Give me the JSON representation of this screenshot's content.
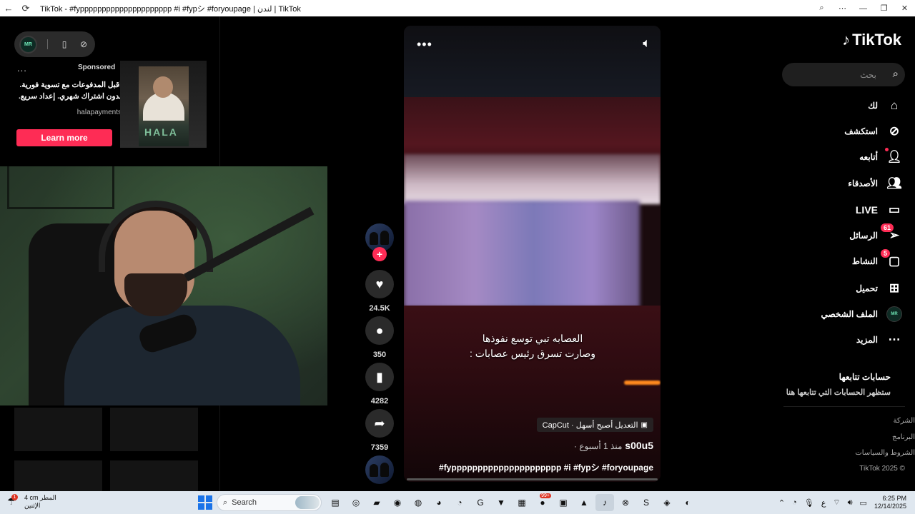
{
  "window": {
    "title": "TikTok - #fyppppppppppppppppppppp #i #fypシ #foryoupage | لندن | TikTok",
    "controls": [
      "zoom-icon",
      "more-icon",
      "minimize-icon",
      "maximize-icon",
      "close-icon"
    ]
  },
  "left": {
    "ad": {
      "more": "...",
      "sponsored_label": "Sponsored",
      "text": "اقبل المدفوعات مع تسوية فورية. بدون اشتراك شهري. إعداد سريع.",
      "brand": "halapayments",
      "cta": "Learn more",
      "thumb_logo": "HALA"
    }
  },
  "video": {
    "more": "•••",
    "caption_line1": "العصابه تبي توسع نفوذها",
    "caption_line2": "وصارت تسرق رئيس عصابات :",
    "capcut_label": "CapCut · التعديل أصبح أسهل",
    "author": "s00u5",
    "posted_ago": "· منذ 1 أسبوع",
    "hashtags": "#fyppppppppppppppppppppp #i #fypシ #foryoupage"
  },
  "actions": {
    "likes": "24.5K",
    "comments": "350",
    "saves": "4282",
    "shares": "7359"
  },
  "sidebar": {
    "brand": "TikTok",
    "search_placeholder": "بحث",
    "items": [
      {
        "label": "لك",
        "icon": "home-icon"
      },
      {
        "label": "استكشف",
        "icon": "compass-icon"
      },
      {
        "label": "أتابعه",
        "icon": "following-icon"
      },
      {
        "label": "الأصدقاء",
        "icon": "friends-icon"
      },
      {
        "label": "LIVE",
        "icon": "live-icon"
      },
      {
        "label": "الرسائل",
        "icon": "messages-icon",
        "badge": "61"
      },
      {
        "label": "النشاط",
        "icon": "activity-icon",
        "badge": "5"
      },
      {
        "label": "تحميل",
        "icon": "upload-icon"
      },
      {
        "label": "الملف الشخصي",
        "icon": "profile-icon"
      },
      {
        "label": "المزيد",
        "icon": "more-icon"
      }
    ],
    "following_heading": "حسابات تتابعها",
    "following_sub": "ستظهر الحسابات التي تتابعها هنا",
    "footer": [
      "الشركة",
      "البرنامج",
      "الشروط والسياسات",
      "© 2025 TikTok"
    ]
  },
  "taskbar": {
    "weather_line1": "4 cm المطر",
    "weather_line2": "الإثنين",
    "weather_badge": "1",
    "search_label": "Search",
    "time": "6:25 PM",
    "date": "12/14/2025",
    "lang": "ع",
    "app_badge": "99+"
  }
}
